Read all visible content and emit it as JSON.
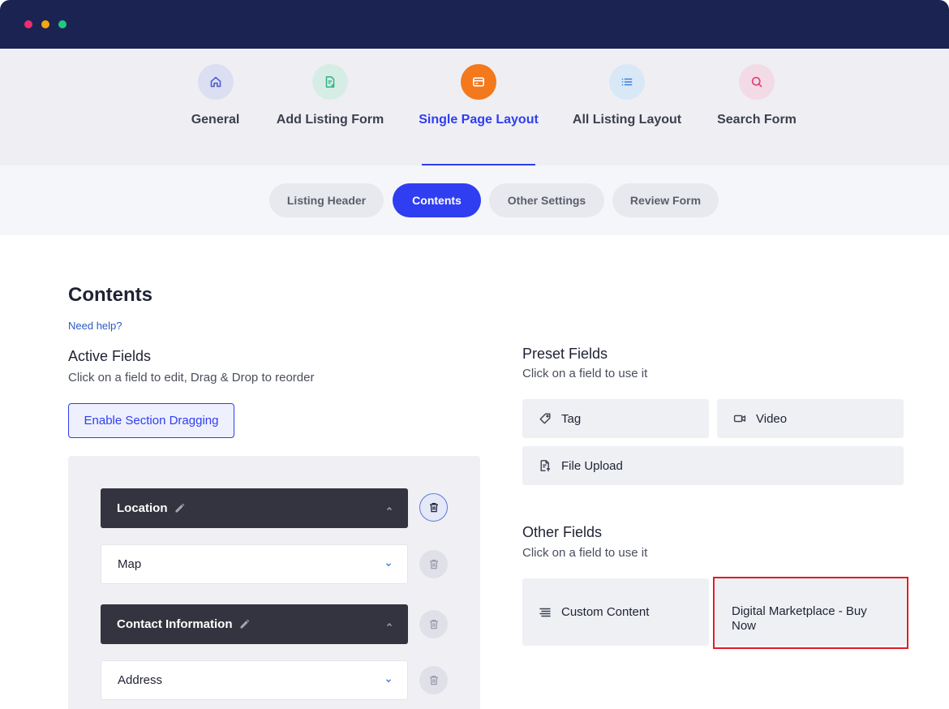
{
  "window": {
    "dot_colors": [
      "#ee2d6e",
      "#f3a713",
      "#22c784"
    ]
  },
  "main_tabs": [
    {
      "label": "General",
      "icon": "home-icon",
      "bg": "#dcdef2",
      "color": "#4f5ec9"
    },
    {
      "label": "Add Listing Form",
      "icon": "form-document-icon",
      "bg": "#d6ede6",
      "color": "#2fb486"
    },
    {
      "label": "Single Page Layout",
      "icon": "card-layout-icon",
      "bg": "#f4781c",
      "color": "#ffffff"
    },
    {
      "label": "All Listing Layout",
      "icon": "list-icon",
      "bg": "#d9e8f6",
      "color": "#3b7fe0"
    },
    {
      "label": "Search Form",
      "icon": "search-icon",
      "bg": "#f3dbe5",
      "color": "#e23d72"
    }
  ],
  "sub_tabs": [
    "Listing Header",
    "Contents",
    "Other Settings",
    "Review Form"
  ],
  "content": {
    "title": "Contents",
    "help_link": "Need help?",
    "active_fields": {
      "title": "Active Fields",
      "subtitle": "Click on a field to edit, Drag & Drop to reorder",
      "enable_button": "Enable Section Dragging",
      "rows": [
        "Location",
        "Map",
        "Contact Information",
        "Address"
      ]
    },
    "preset_fields": {
      "title": "Preset Fields",
      "subtitle": "Click on a field to use it",
      "items": [
        "Tag",
        "Video",
        "File Upload"
      ]
    },
    "other_fields": {
      "title": "Other Fields",
      "subtitle": "Click on a field to use it",
      "items": [
        "Custom Content",
        "Digital Marketplace - Buy Now"
      ]
    }
  },
  "colors": {
    "accent": "#2f3ef0",
    "highlight": "#e01c24"
  }
}
